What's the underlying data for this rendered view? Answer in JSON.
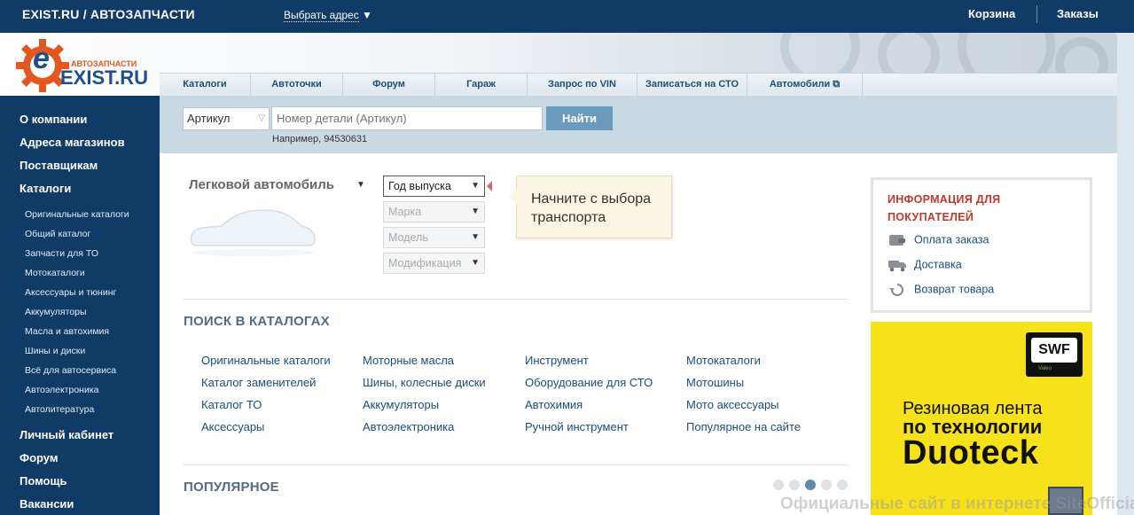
{
  "topbar": {
    "brand": "EXIST.RU / АВТОЗАПЧАСТИ",
    "address_label": "Выбрать адрес",
    "address_arrow": "▼",
    "cart": "Корзина",
    "orders": "Заказы"
  },
  "logo": {
    "tagline": "АВТОЗАПЧАСТИ",
    "name": "EXIST.RU",
    "letter": "e"
  },
  "nav": {
    "tabs": [
      {
        "label": "Каталоги"
      },
      {
        "label": "Автоточки"
      },
      {
        "label": "Форум"
      },
      {
        "label": "Гараж"
      },
      {
        "label": "Запрос по VIN"
      },
      {
        "label": "Записаться на СТО"
      },
      {
        "label": "Автомобили ⧉"
      }
    ]
  },
  "search": {
    "type_selected": "Артикул",
    "placeholder": "Номер детали (Артикул)",
    "button": "Найти",
    "example": "Например, 94530631"
  },
  "sidebar": {
    "main_top": [
      "О компании",
      "Адреса магазинов",
      "Поставщикам",
      "Каталоги"
    ],
    "sub": [
      "Оригинальные каталоги",
      "Общий каталог",
      "Запчасти для ТО",
      "Мотокаталоги",
      "Аксессуары и тюнинг",
      "Аккумуляторы",
      "Масла и автохимия",
      "Шины и диски",
      "Всё для автосервиса",
      "Автоэлектроника",
      "Автолитература"
    ],
    "main_bottom": [
      "Личный кабинет",
      "Форум",
      "Помощь",
      "Вакансии"
    ]
  },
  "vehicle": {
    "type": "Легковой автомобиль",
    "type_arrow": "▼",
    "dropdowns": [
      "Год выпуска",
      "Марка",
      "Модель",
      "Модификация"
    ],
    "tooltip": "Начните с выбора транспорта"
  },
  "catalogs": {
    "title": "ПОИСК В КАТАЛОГАХ",
    "columns": [
      [
        "Оригинальные каталоги",
        "Каталог заменителей",
        "Каталог ТО",
        "Аксессуары"
      ],
      [
        "Моторные масла",
        "Шины, колесные диски",
        "Аккумуляторы",
        "Автоэлектроника"
      ],
      [
        "Инструмент",
        "Оборудование для СТО",
        "Автохимия",
        "Ручной инструмент"
      ],
      [
        "Мотокаталоги",
        "Мотошины",
        "Мото аксессуары",
        "Популярное на сайте"
      ]
    ]
  },
  "popular": {
    "title": "ПОПУЛЯРНОЕ",
    "dots_total": 5,
    "dot_active": 3
  },
  "info": {
    "title": "ИНФОРМАЦИЯ ДЛЯ ПОКУПАТЕЛЕЙ",
    "items": [
      {
        "label": "Оплата заказа",
        "icon": "wallet-icon"
      },
      {
        "label": "Доставка",
        "icon": "truck-icon"
      },
      {
        "label": "Возврат товара",
        "icon": "return-icon"
      }
    ]
  },
  "ad": {
    "logo": "SWF",
    "logo_sub": "Valeo",
    "line1": "Резиновая лента",
    "line2": "по технологии",
    "line3": "Duoteck"
  },
  "watermark": "Официальные сайт в интернете SiteOfficial.ru",
  "colors": {
    "navy": "#0f3b66",
    "accent_red": "#c0392b",
    "link_blue": "#1a4e7e",
    "ad_yellow": "#f7e11b",
    "button": "#6a9bbd"
  }
}
